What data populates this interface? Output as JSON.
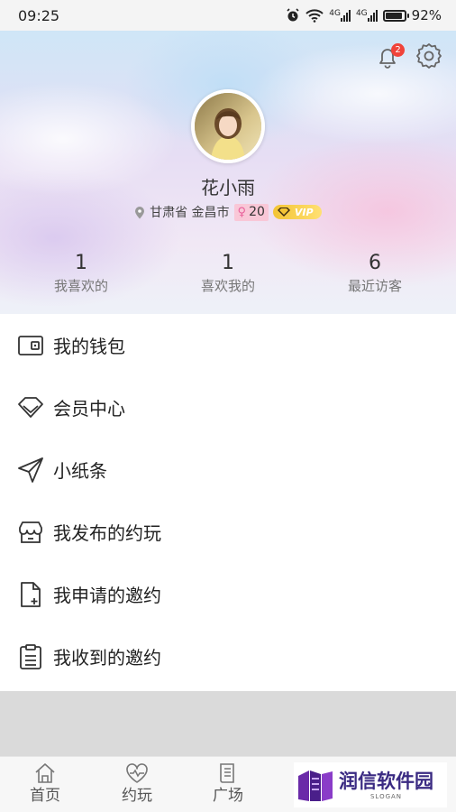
{
  "status_bar": {
    "time": "09:25",
    "network_1": "4G",
    "network_2": "4G",
    "battery": "92%",
    "battery_level": 0.92
  },
  "profile": {
    "notification_count": "2",
    "name": "花小雨",
    "location": "甘肃省 金昌市",
    "gender_symbol": "♀",
    "age": "20",
    "vip_label": "VIP"
  },
  "stats": [
    {
      "value": "1",
      "label": "我喜欢的"
    },
    {
      "value": "1",
      "label": "喜欢我的"
    },
    {
      "value": "6",
      "label": "最近访客"
    }
  ],
  "menu": [
    {
      "label": "我的钱包",
      "icon": "wallet-icon"
    },
    {
      "label": "会员中心",
      "icon": "diamond-icon"
    },
    {
      "label": "小纸条",
      "icon": "paper-plane-icon"
    },
    {
      "label": "我发布的约玩",
      "icon": "store-icon"
    },
    {
      "label": "我申请的邀约",
      "icon": "document-add-icon"
    },
    {
      "label": "我收到的邀约",
      "icon": "clipboard-icon"
    }
  ],
  "tabbar": [
    {
      "label": "首页",
      "icon": "home-icon"
    },
    {
      "label": "约玩",
      "icon": "heartbeat-icon"
    },
    {
      "label": "广场",
      "icon": "book-icon"
    }
  ],
  "watermark": {
    "title": "润信软件园",
    "slogan": "SLOGAN"
  },
  "colors": {
    "badge": "#f0433a",
    "vip": "#f3c434",
    "age_badge": "#f9c7d7",
    "watermark_text": "#3a2a82"
  }
}
